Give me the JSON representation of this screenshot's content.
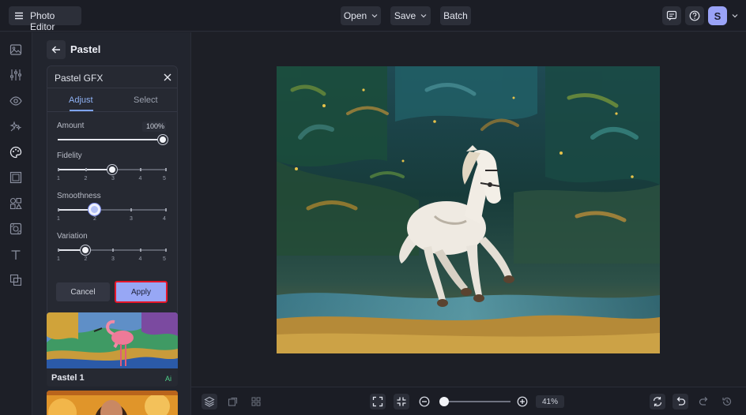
{
  "app": {
    "title": "Photo Editor",
    "avatar_letter": "S"
  },
  "toolbar": {
    "open_label": "Open",
    "save_label": "Save",
    "batch_label": "Batch"
  },
  "panel": {
    "title": "Pastel",
    "card": {
      "title": "Pastel GFX",
      "tabs": [
        {
          "label": "Adjust",
          "active": true
        },
        {
          "label": "Select",
          "active": false
        }
      ],
      "amount": {
        "label": "Amount",
        "value": "100%",
        "fraction": 1.0
      },
      "fidelity": {
        "label": "Fidelity",
        "ticks": [
          "1",
          "2",
          "3",
          "4",
          "5"
        ],
        "value": 3
      },
      "smoothness": {
        "label": "Smoothness",
        "ticks": [
          "1",
          "2",
          "3",
          "4"
        ],
        "value": 2
      },
      "variation": {
        "label": "Variation",
        "ticks": [
          "1",
          "2",
          "3",
          "4",
          "5"
        ],
        "value": 2
      },
      "cancel_label": "Cancel",
      "apply_label": "Apply"
    },
    "presets": [
      {
        "label": "Pastel 1",
        "badge": "Ai"
      }
    ]
  },
  "zoom": {
    "value": "41%"
  },
  "colors": {
    "accent": "#97a7f5",
    "highlight": "#e5162a",
    "ai_badge": "#4fd28a"
  }
}
